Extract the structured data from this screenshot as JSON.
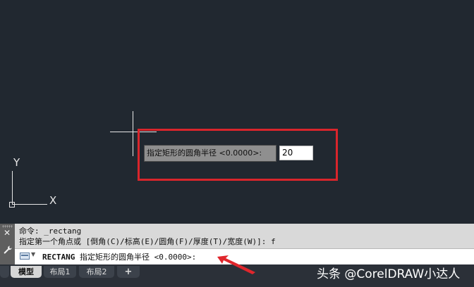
{
  "tooltip": {
    "prompt_label": "指定矩形的圆角半径 <0.0000>:",
    "input_value": "20"
  },
  "ucs": {
    "y_label": "Y",
    "x_label": "X"
  },
  "command": {
    "history_1": "命令: _rectang",
    "history_2": "指定第一个角点或 [倒角(C)/标高(E)/圆角(F)/厚度(T)/宽度(W)]: f",
    "current_cmd": "RECTANG",
    "current_prompt": " 指定矩形的圆角半径 <0.0000>:",
    "close_symbol": "✕",
    "dropdown_symbol": "▼"
  },
  "tabs": {
    "model": "模型",
    "layout1": "布局1",
    "layout2": "布局2",
    "add": "+"
  },
  "watermark": "头条 @CorelDRAW小达人",
  "colors": {
    "canvas_bg": "#212830",
    "highlight": "#d9252b",
    "panel_bg": "#d9d9d9"
  },
  "icons": [
    "close-icon",
    "wrench-icon",
    "command-input-icon",
    "chevron-down-icon"
  ]
}
